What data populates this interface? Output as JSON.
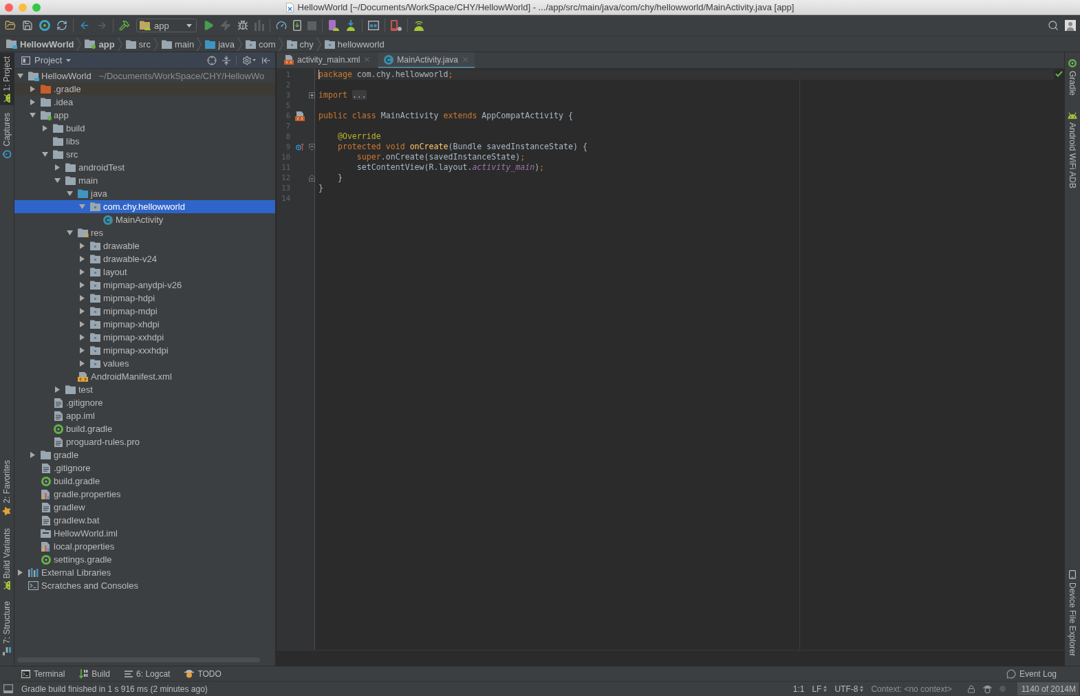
{
  "window": {
    "title": "HellowWorld [~/Documents/WorkSpace/CHY/HellowWorld] - .../app/src/main/java/com/chy/hellowworld/MainActivity.java [app]"
  },
  "toolbar": {
    "run_configuration": "app"
  },
  "breadcrumbs": [
    {
      "label": "HellowWorld",
      "kind": "project"
    },
    {
      "label": "app",
      "kind": "module"
    },
    {
      "label": "src",
      "kind": "folder"
    },
    {
      "label": "main",
      "kind": "folder"
    },
    {
      "label": "java",
      "kind": "source"
    },
    {
      "label": "com",
      "kind": "package"
    },
    {
      "label": "chy",
      "kind": "package"
    },
    {
      "label": "hellowworld",
      "kind": "package"
    }
  ],
  "left_tool_tabs": {
    "top": [
      {
        "label": "1: Project",
        "kind": "project",
        "selected": true
      },
      {
        "label": "Captures",
        "kind": "captures",
        "selected": false
      }
    ],
    "bottom": [
      {
        "label": "2: Favorites",
        "kind": "favorites",
        "selected": false
      },
      {
        "label": "Build Variants",
        "kind": "variants",
        "selected": false
      },
      {
        "label": "7: Structure",
        "kind": "structure",
        "selected": false
      }
    ]
  },
  "project_panel": {
    "view": "Project",
    "tree": [
      {
        "label": "HellowWorld",
        "path": "~/Documents/WorkSpace/CHY/HellowWo",
        "kind": "project",
        "expanded": true,
        "selected": false,
        "children": [
          {
            "label": ".gradle",
            "kind": "excluded",
            "expanded": false,
            "selected": false
          },
          {
            "label": ".idea",
            "kind": "folder",
            "expanded": false,
            "selected": false
          },
          {
            "label": "app",
            "kind": "module",
            "expanded": true,
            "selected": false,
            "children": [
              {
                "label": "build",
                "kind": "folder",
                "expanded": false,
                "selected": false
              },
              {
                "label": "libs",
                "kind": "folder",
                "selected": false
              },
              {
                "label": "src",
                "kind": "folder",
                "expanded": true,
                "selected": false,
                "children": [
                  {
                    "label": "androidTest",
                    "kind": "folder",
                    "expanded": false,
                    "selected": false
                  },
                  {
                    "label": "main",
                    "kind": "folder",
                    "expanded": true,
                    "selected": false,
                    "children": [
                      {
                        "label": "java",
                        "kind": "source",
                        "expanded": true,
                        "selected": false,
                        "children": [
                          {
                            "label": "com.chy.hellowworld",
                            "kind": "package",
                            "expanded": true,
                            "selected": true,
                            "children": [
                              {
                                "label": "MainActivity",
                                "kind": "class",
                                "selected": false
                              }
                            ]
                          }
                        ]
                      },
                      {
                        "label": "res",
                        "kind": "resources",
                        "expanded": true,
                        "selected": false,
                        "children": [
                          {
                            "label": "drawable",
                            "kind": "package",
                            "expanded": false,
                            "selected": false
                          },
                          {
                            "label": "drawable-v24",
                            "kind": "package",
                            "expanded": false,
                            "selected": false
                          },
                          {
                            "label": "layout",
                            "kind": "package",
                            "expanded": false,
                            "selected": false
                          },
                          {
                            "label": "mipmap-anydpi-v26",
                            "kind": "package",
                            "expanded": false,
                            "selected": false
                          },
                          {
                            "label": "mipmap-hdpi",
                            "kind": "package",
                            "expanded": false,
                            "selected": false
                          },
                          {
                            "label": "mipmap-mdpi",
                            "kind": "package",
                            "expanded": false,
                            "selected": false
                          },
                          {
                            "label": "mipmap-xhdpi",
                            "kind": "package",
                            "expanded": false,
                            "selected": false
                          },
                          {
                            "label": "mipmap-xxhdpi",
                            "kind": "package",
                            "expanded": false,
                            "selected": false
                          },
                          {
                            "label": "mipmap-xxxhdpi",
                            "kind": "package",
                            "expanded": false,
                            "selected": false
                          },
                          {
                            "label": "values",
                            "kind": "package",
                            "expanded": false,
                            "selected": false
                          }
                        ]
                      },
                      {
                        "label": "AndroidManifest.xml",
                        "kind": "manifest",
                        "selected": false
                      }
                    ]
                  },
                  {
                    "label": "test",
                    "kind": "folder",
                    "expanded": false,
                    "selected": false
                  }
                ]
              },
              {
                "label": ".gitignore",
                "kind": "text",
                "selected": false
              },
              {
                "label": "app.iml",
                "kind": "text",
                "selected": false
              },
              {
                "label": "build.gradle",
                "kind": "gradle",
                "selected": false
              },
              {
                "label": "proguard-rules.pro",
                "kind": "text",
                "selected": false
              }
            ]
          },
          {
            "label": "gradle",
            "kind": "folder",
            "expanded": false,
            "selected": false
          },
          {
            "label": ".gitignore",
            "kind": "text",
            "selected": false
          },
          {
            "label": "build.gradle",
            "kind": "gradle",
            "selected": false
          },
          {
            "label": "gradle.properties",
            "kind": "properties",
            "selected": false
          },
          {
            "label": "gradlew",
            "kind": "text",
            "selected": false
          },
          {
            "label": "gradlew.bat",
            "kind": "text",
            "selected": false
          },
          {
            "label": "HellowWorld.iml",
            "kind": "iml",
            "selected": false
          },
          {
            "label": "local.properties",
            "kind": "properties",
            "selected": false
          },
          {
            "label": "settings.gradle",
            "kind": "gradle",
            "selected": false
          }
        ]
      },
      {
        "label": "External Libraries",
        "kind": "libraries",
        "expanded": false,
        "selected": false
      },
      {
        "label": "Scratches and Consoles",
        "kind": "scratches",
        "selected": false
      }
    ]
  },
  "editor": {
    "tabs": [
      {
        "label": "activity_main.xml",
        "kind": "xml",
        "selected": false
      },
      {
        "label": "MainActivity.java",
        "kind": "class",
        "selected": true
      }
    ],
    "lines": [
      {
        "number": "1",
        "current": true,
        "tokens": [
          {
            "kind": "keyword",
            "text": "package"
          },
          {
            "kind": "plain",
            "text": " com.chy.hellowworld"
          },
          {
            "kind": "keyword",
            "text": ";"
          }
        ]
      },
      {
        "number": "2",
        "current": false
      },
      {
        "number": "3",
        "current": false,
        "gutter": [
          {
            "kind": "collapsed"
          }
        ],
        "tokens": [
          {
            "kind": "keyword",
            "text": "import "
          },
          {
            "kind": "folded",
            "text": "..."
          }
        ]
      },
      {
        "number": "5",
        "current": false
      },
      {
        "number": "6",
        "current": false,
        "gutter": [
          {
            "kind": "layout"
          }
        ],
        "tokens": [
          {
            "kind": "keyword",
            "text": "public class"
          },
          {
            "kind": "plain",
            "text": " MainActivity "
          },
          {
            "kind": "keyword",
            "text": "extends"
          },
          {
            "kind": "plain",
            "text": " AppCompatActivity {"
          }
        ]
      },
      {
        "number": "7",
        "current": false
      },
      {
        "number": "8",
        "current": false,
        "tokens": [
          {
            "kind": "annotation",
            "text": "    @Override"
          }
        ]
      },
      {
        "number": "9",
        "current": false,
        "gutter": [
          {
            "kind": "override"
          },
          {
            "kind": "open"
          }
        ],
        "tokens": [
          {
            "kind": "keyword",
            "text": "    protected void "
          },
          {
            "kind": "method",
            "text": "onCreate"
          },
          {
            "kind": "plain",
            "text": "(Bundle savedInstanceState) {"
          }
        ]
      },
      {
        "number": "10",
        "current": false,
        "tokens": [
          {
            "kind": "keyword",
            "text": "        super"
          },
          {
            "kind": "plain",
            "text": ".onCreate(savedInstanceState)"
          },
          {
            "kind": "keyword",
            "text": ";"
          }
        ]
      },
      {
        "number": "11",
        "current": false,
        "tokens": [
          {
            "kind": "plain",
            "text": "        setContentView(R.layout."
          },
          {
            "kind": "field",
            "text": "activity_main"
          },
          {
            "kind": "plain",
            "text": ")"
          },
          {
            "kind": "keyword",
            "text": ";"
          }
        ]
      },
      {
        "number": "12",
        "current": false,
        "gutter": [
          {
            "kind": "end"
          }
        ],
        "tokens": [
          {
            "kind": "plain",
            "text": "    }"
          }
        ]
      },
      {
        "number": "13",
        "current": false,
        "tokens": [
          {
            "kind": "plain",
            "text": "}"
          }
        ]
      },
      {
        "number": "14",
        "current": false
      }
    ]
  },
  "right_tool_tabs": {
    "top": [
      {
        "label": "Gradle",
        "kind": "gradle"
      },
      {
        "label": "Android WiFi ADB",
        "kind": "adb"
      }
    ],
    "bottom": [
      {
        "label": "Device File Explorer",
        "kind": "devices"
      }
    ]
  },
  "bottom_tool_tabs": [
    {
      "label": "Terminal",
      "kind": "terminal"
    },
    {
      "label": "Build",
      "kind": "build"
    },
    {
      "label": "6: Logcat",
      "kind": "logcat"
    },
    {
      "label": "TODO",
      "kind": "todo"
    }
  ],
  "event_log": {
    "label": "Event Log"
  },
  "status_bar": {
    "message": "Gradle build finished in 1 s 916 ms (2 minutes ago)",
    "position": "1:1",
    "line_separator": "LF",
    "encoding": "UTF-8",
    "context": "Context: <no context>",
    "memory": "1140 of 2014M"
  }
}
